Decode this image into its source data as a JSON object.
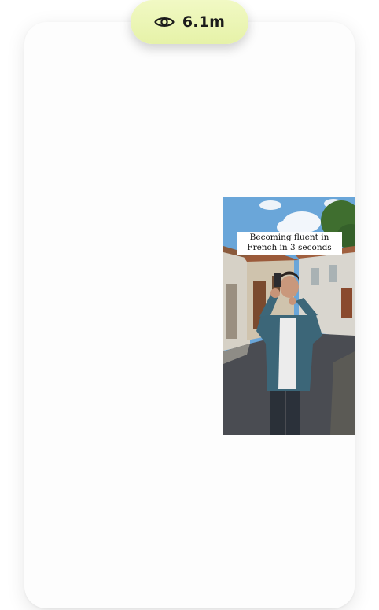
{
  "views": {
    "icon": "eye-icon",
    "count": "6.1m"
  },
  "video": {
    "caption": "Becoming fluent in French in 3 seconds"
  },
  "colors": {
    "pill_bg": "#eef7bd",
    "card_bg": "#fdfdfd",
    "sky": "#6fa9d8"
  }
}
